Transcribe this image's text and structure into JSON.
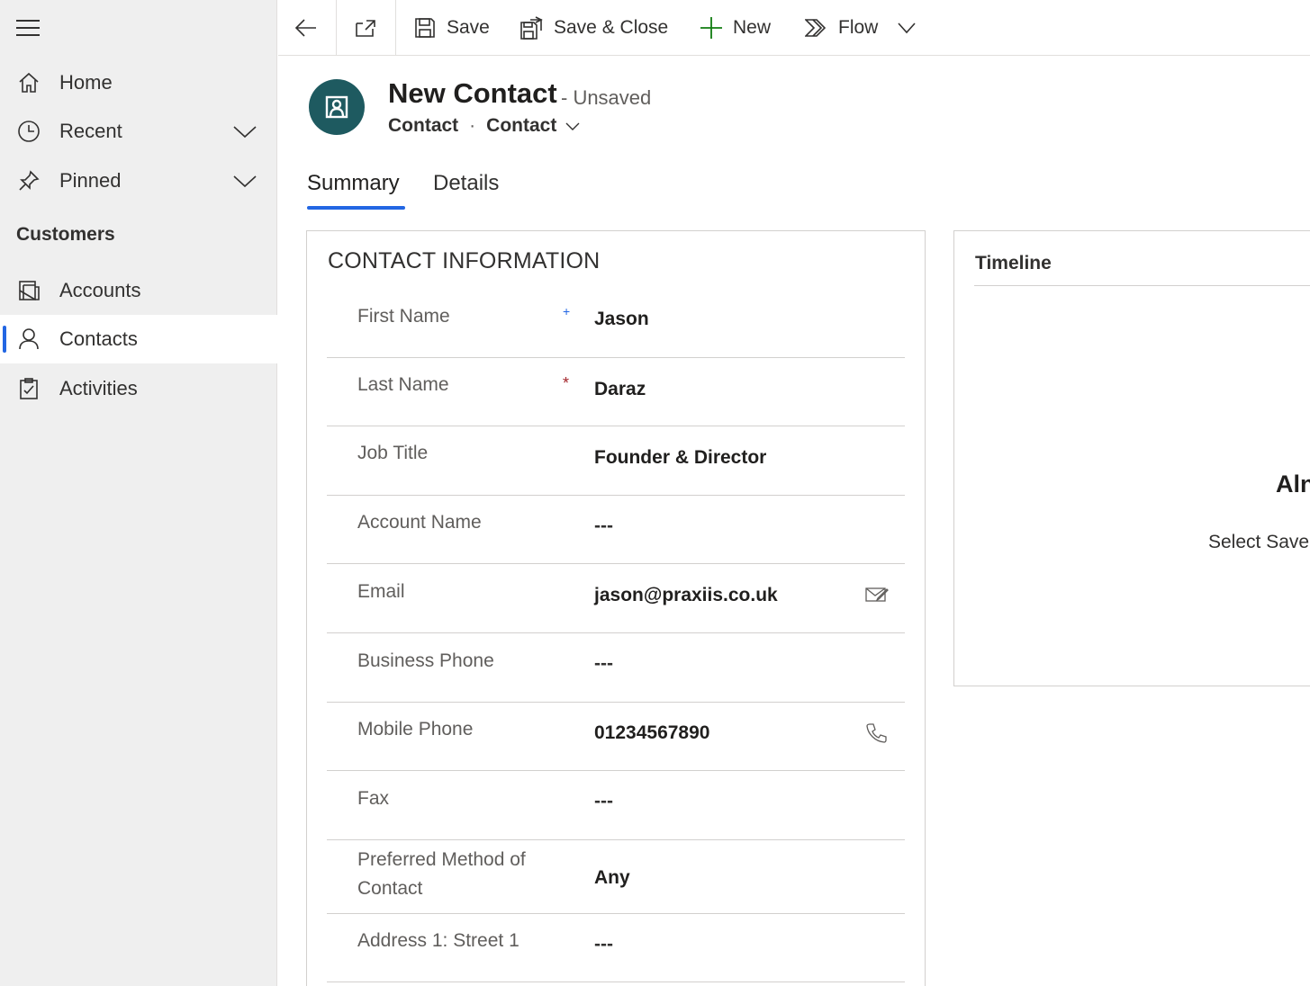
{
  "sidebar": {
    "items": [
      {
        "label": "Home",
        "icon": "home-icon"
      },
      {
        "label": "Recent",
        "icon": "clock-icon"
      },
      {
        "label": "Pinned",
        "icon": "pin-icon"
      }
    ],
    "section_title": "Customers",
    "section_items": [
      {
        "label": "Accounts",
        "icon": "accounts-icon"
      },
      {
        "label": "Contacts",
        "icon": "contact-person-icon",
        "selected": true
      },
      {
        "label": "Activities",
        "icon": "clipboard-icon"
      }
    ],
    "accent_color": "#2266e3"
  },
  "toolbar": {
    "save_label": "Save",
    "save_close_label": "Save & Close",
    "new_label": "New",
    "flow_label": "Flow"
  },
  "header": {
    "title": "New Contact",
    "status": "- Unsaved",
    "entity": "Contact",
    "form_selector": "Contact",
    "avatar_color": "#1e5a60"
  },
  "tabs": [
    {
      "label": "Summary",
      "active": true
    },
    {
      "label": "Details",
      "active": false
    }
  ],
  "contact_info": {
    "heading": "CONTACT INFORMATION",
    "fields": [
      {
        "label": "First Name",
        "value": "Jason",
        "marker": "+"
      },
      {
        "label": "Last Name",
        "value": "Daraz",
        "marker": "*"
      },
      {
        "label": "Job Title",
        "value": "Founder & Director"
      },
      {
        "label": "Account Name",
        "value": "---"
      },
      {
        "label": "Email",
        "value": "jason@praxiis.co.uk"
      },
      {
        "label": "Business Phone",
        "value": "---"
      },
      {
        "label": "Mobile Phone",
        "value": "01234567890"
      },
      {
        "label": "Fax",
        "value": "---"
      },
      {
        "label": "Preferred Method of Contact",
        "value": "Any"
      },
      {
        "label": "Address 1: Street 1",
        "value": "---"
      }
    ]
  },
  "timeline": {
    "title": "Timeline",
    "heading": "Aln",
    "message": "Select Save"
  }
}
